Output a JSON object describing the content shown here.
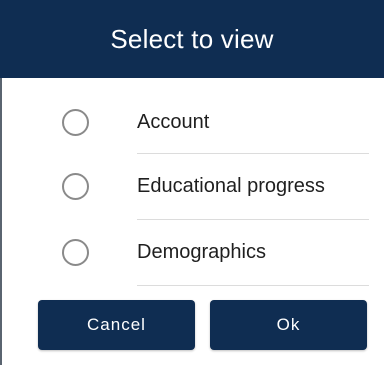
{
  "dialog": {
    "title": "Select to view",
    "options": [
      {
        "label": "Account",
        "selected": false
      },
      {
        "label": "Educational progress",
        "selected": false
      },
      {
        "label": "Demographics",
        "selected": false
      }
    ],
    "buttons": {
      "cancel_label": "Cancel",
      "ok_label": "Ok"
    }
  },
  "colors": {
    "primary": "#0f2d52",
    "radio_border": "#8a8a8a",
    "divider": "#dcdcdc"
  }
}
